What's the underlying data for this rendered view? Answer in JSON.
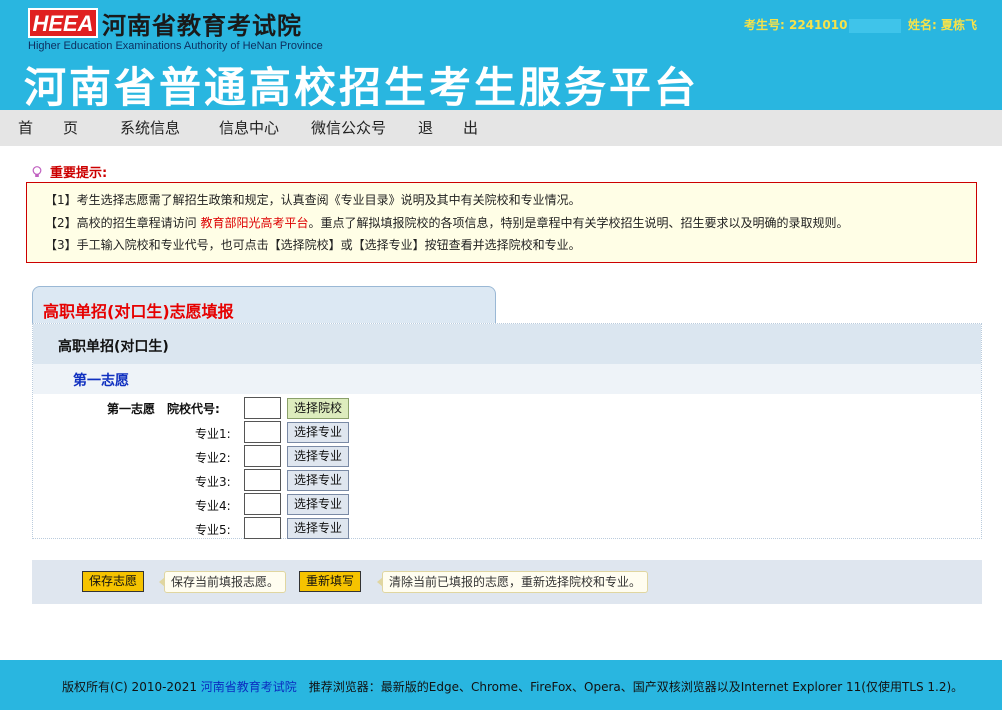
{
  "header": {
    "logo_text": "HEEA",
    "org_name": "河南省教育考试院",
    "org_name_en": "Higher Education Examinations Authority of HeNan Province",
    "platform_title": "河南省普通高校招生考生服务平台",
    "candidate_label": "考生号: 2241010",
    "name_label": "姓名: 夏栋飞"
  },
  "nav": {
    "items": [
      {
        "label": "首　　页"
      },
      {
        "label": "系统信息"
      },
      {
        "label": "信息中心"
      },
      {
        "label": "微信公众号"
      },
      {
        "label": "退　　出"
      }
    ]
  },
  "notice": {
    "title": "重要提示:",
    "line1": "【1】考生选择志愿需了解招生政策和规定，认真查阅《专业目录》说明及其中有关院校和专业情况。",
    "line2_pre": "【2】高校的招生章程请访问 ",
    "line2_link": "教育部阳光高考平台",
    "line2_post": "。重点了解拟填报院校的各项信息，特别是章程中有关学校招生说明、招生要求以及明确的录取规则。",
    "line3": "【3】手工输入院校和专业代号，也可点击【选择院校】或【选择专业】按钮查看并选择院校和专业。"
  },
  "form": {
    "tab_label": "高职单招(对口生)志愿填报",
    "section_title": "高职单招(对口生)",
    "choice_title": "第一志愿",
    "school_label": "第一志愿　院校代号:",
    "select_school_label": "选择院校",
    "majors": [
      {
        "label": "专业1:",
        "button": "选择专业"
      },
      {
        "label": "专业2:",
        "button": "选择专业"
      },
      {
        "label": "专业3:",
        "button": "选择专业"
      },
      {
        "label": "专业4:",
        "button": "选择专业"
      },
      {
        "label": "专业5:",
        "button": "选择专业"
      }
    ]
  },
  "actions": {
    "save_label": "保存志愿",
    "save_tip": "保存当前填报志愿。",
    "reset_label": "重新填写",
    "reset_tip": "清除当前已填报的志愿，重新选择院校和专业。"
  },
  "footer": {
    "copyright": "版权所有(C) 2010-2021 ",
    "org_link": "河南省教育考试院",
    "browsers": "　推荐浏览器：最新版的Edge、Chrome、FireFox、Opera、国产双核浏览器以及Internet Explorer 11(仅使用TLS 1.2)。"
  },
  "colors": {
    "brand_blue": "#29b6e0",
    "accent_red": "#e60000",
    "button_yellow": "#f6c300",
    "user_info_yellow": "#f6e24a"
  }
}
